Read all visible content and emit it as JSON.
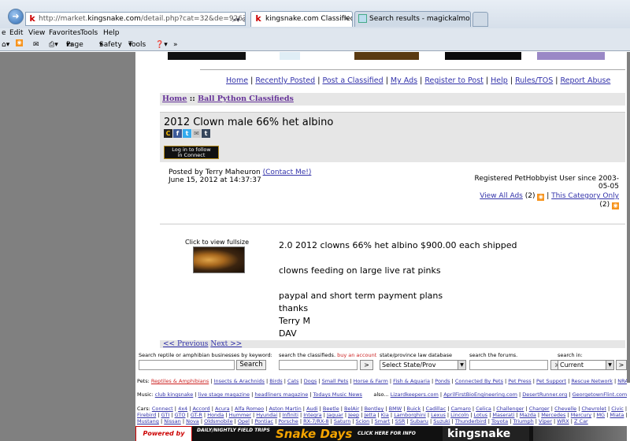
{
  "browser": {
    "address_url": "http://market.",
    "address_domain": "kingsnake.com",
    "address_rest": "/detail.php?cat=32&de=926744",
    "tabs": [
      {
        "label": "kingsnake.com Classifieds: ..."
      },
      {
        "label": "Search results - magickalmorp..."
      }
    ],
    "menu": [
      "Edit",
      "View",
      "Favorites",
      "Tools",
      "Help"
    ],
    "command_bar": [
      "Page",
      "Safety",
      "Tools"
    ]
  },
  "top_nav": {
    "links": [
      "Home",
      "Recently Posted",
      "Post a Classified",
      "My Ads",
      "Register to Post",
      "Help",
      "Rules/TOS",
      "Report Abuse"
    ],
    "separator": " | "
  },
  "breadcrumb": {
    "home": "Home",
    "sep": " :: ",
    "category": "Ball Python Classifieds"
  },
  "ad": {
    "title": "2012 Clown male 66% het albino",
    "follow_button_line1": "Log in to follow",
    "follow_button_line2": "in Connect",
    "posted_by_prefix": "Posted by Terry Maheuron ",
    "contact_link": "(Contact Me!)",
    "posted_date": "June 15, 2012 at 14:37:37",
    "registered_line1": "Registered PetHobbyist User since 2003-",
    "registered_line2": "05-05",
    "view_all_ads": "View All Ads",
    "view_all_count": "(2)",
    "this_category": "This Category Only",
    "this_category_count": "(2)",
    "thumb_label": "Click to view fullsize",
    "body_lines": [
      "2.0 2012 clowns 66% het albino $900.00 each shipped",
      "",
      "clowns feeding on large live rat pinks",
      "",
      "paypal and short term payment plans",
      "thanks",
      "Terry M",
      "DAV"
    ],
    "prev": "<< Previous",
    "next": "Next >>"
  },
  "search": {
    "business_label": "Search reptile or amphibian businesses by keyword:",
    "business_button": "Search",
    "classifieds_label": "search the classifieds.",
    "buy_account": "buy an account",
    "state_label": "state/province law database",
    "state_select": "Select State/Prov",
    "forums_label": "search the forums.",
    "search_in_label": "search in:",
    "search_in_value": "Current",
    "go": ">"
  },
  "footer": {
    "pets_prefix": "Pets:",
    "pets_links": [
      "Reptiles & Amphibians",
      "Insects & Arachnids",
      "Birds",
      "Cats",
      "Dogs",
      "Small Pets",
      "Horse & Farm",
      "Fish & Aquaria",
      "Ponds",
      "Connected By Pets",
      "Pet Press",
      "Pet Support",
      "Rescue Network",
      "NRAAC.ORG"
    ],
    "music_prefix": "Music:",
    "music_links": [
      "club kingsnake",
      "live stage magazine",
      "headliners magazine",
      "Todays Music News"
    ],
    "also_prefix": "also...",
    "also_links": [
      "Lizardkeepers.com",
      "AprilFirstBioEngineering.com",
      "DesertRunner.org",
      "GeorgetownFlint.com",
      "jeffbarringer.com"
    ],
    "cars_prefix": "Cars:",
    "cars_line1": [
      "Connect",
      "4x4",
      "Accord",
      "Acura",
      "Alfa Romeo",
      "Aston Martin",
      "Audi",
      "Beetle",
      "BelAir",
      "Bentley",
      "BMW",
      "Buick",
      "Cadillac",
      "Camaro",
      "Celica",
      "Challenger",
      "Charger",
      "Chevelle",
      "Chevrolet",
      "Civic",
      "Corvette",
      "Eclipse",
      "Ferrari"
    ],
    "cars_line2": [
      "Firebird",
      "GTI",
      "GTO",
      "GT-R",
      "Honda",
      "Hummer",
      "Hyundai",
      "Infiniti",
      "Integra",
      "Jaguar",
      "Jeep",
      "Jetta",
      "Kia",
      "Lamborghini",
      "Lexus",
      "Lincoln",
      "Lotus",
      "Maserati",
      "Mazda",
      "Mercedes",
      "Mercury",
      "MG",
      "Miata",
      "Mini",
      "Mitsubishi",
      "MR2"
    ],
    "cars_line3": [
      "Mustang",
      "Nissan",
      "Nova",
      "Oldsmobile",
      "Opel",
      "Pontiac",
      "Porsche",
      "RX-7/RX-8",
      "Saturn",
      "Scion",
      "Smart",
      "SSR",
      "Subaru",
      "Suzuki",
      "Thunderbird",
      "Toyota",
      "Triumph",
      "Viper",
      "WRX",
      "Z Car"
    ]
  },
  "ad_strip": {
    "powered_by": "Powered by",
    "field_trips": "DAILY/NIGHTLY FIELD TRIPS",
    "click_here": "CLICK HERE FOR INFO",
    "snake_days": "Snake Days",
    "kingsnake": "kingsnake"
  },
  "colors": {
    "link": "#3333aa",
    "visited_link": "#663399",
    "panel_gray": "#e6e6e6",
    "side_gray": "#808080",
    "rss_orange": "#f7941d"
  }
}
